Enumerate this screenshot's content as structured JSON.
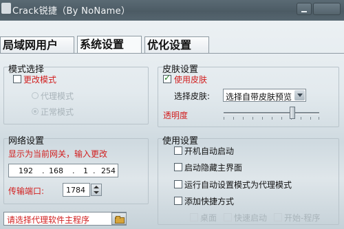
{
  "window": {
    "title": "Crack锐捷（By NoName）"
  },
  "tabs": [
    {
      "label": "局域网用户",
      "active": false
    },
    {
      "label": "系统设置",
      "active": true
    },
    {
      "label": "优化设置",
      "active": false
    }
  ],
  "mode_group": {
    "title": "模式选择",
    "change_mode_label": "更改模式",
    "change_mode_checked": false,
    "proxy_mode_label": "代理模式",
    "normal_mode_label": "正常模式",
    "normal_mode_selected": true
  },
  "skin_group": {
    "title": "皮肤设置",
    "use_skin_label": "使用皮肤",
    "use_skin_checked": true,
    "select_skin_label": "选择皮肤:",
    "select_skin_value": "选择自带皮肤预览",
    "opacity_label": "透明度",
    "opacity_level": 0.72
  },
  "network_group": {
    "title": "网络设置",
    "gateway_hint": "显示为当前网关，输入更改",
    "ip": [
      "192",
      "168",
      "1",
      "254"
    ],
    "port_label": "传输端口:",
    "port_value": "1784"
  },
  "usage_group": {
    "title": "使用设置",
    "options": [
      {
        "label": "开机自动启动",
        "checked": false
      },
      {
        "label": "启动隐藏主界面",
        "checked": false
      },
      {
        "label": "运行自动设置模式为代理模式",
        "checked": false
      },
      {
        "label": "添加快捷方式",
        "checked": false
      }
    ],
    "shortcut_targets": [
      "桌面",
      "快速启动",
      "开始-程序"
    ]
  },
  "proxy_path": {
    "text": "请选择代理软件主程序"
  },
  "colors": {
    "accent_red": "#d21e1e",
    "titlebar": "#4f5e67"
  }
}
